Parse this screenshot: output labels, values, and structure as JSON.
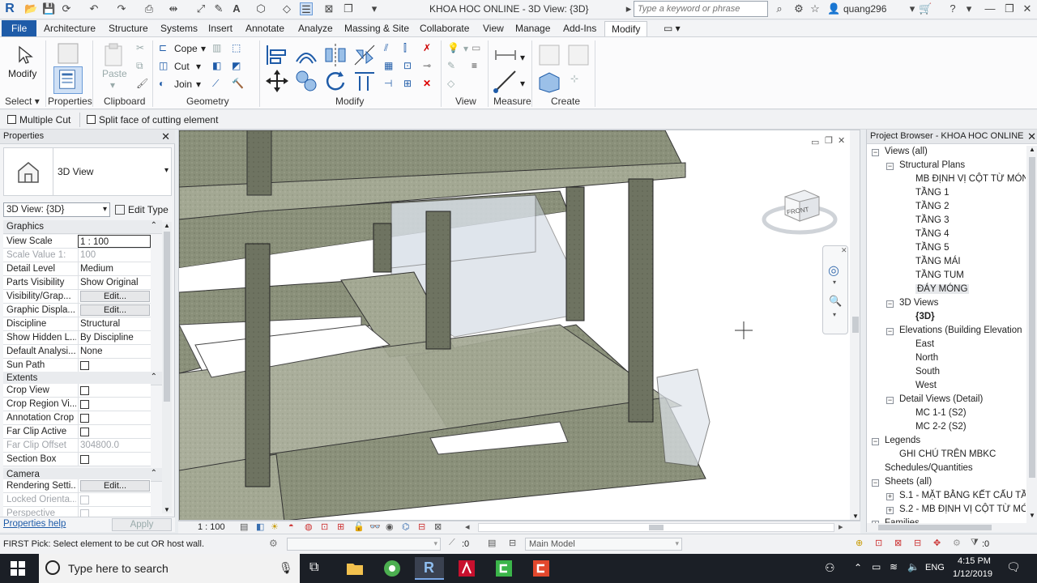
{
  "app": {
    "title": "KHOA HOC ONLINE - 3D View: {3D}",
    "search_placeholder": "Type a keyword or phrase",
    "user": "quang296"
  },
  "ribbon_tabs": [
    "File",
    "Architecture",
    "Structure",
    "Systems",
    "Insert",
    "Annotate",
    "Analyze",
    "Massing & Site",
    "Collaborate",
    "View",
    "Manage",
    "Add-Ins",
    "Modify"
  ],
  "ribbon": {
    "modify_label": "Modify",
    "properties_label": "Properties",
    "paste_label": "Paste",
    "cope_label": "Cope",
    "cut_label": "Cut",
    "join_label": "Join",
    "panels": {
      "select": "Select",
      "properties": "Properties",
      "clipboard": "Clipboard",
      "geometry": "Geometry",
      "modify": "Modify",
      "view": "View",
      "measure": "Measure",
      "create": "Create"
    }
  },
  "options": {
    "multiple_cut": "Multiple Cut",
    "split_face": "Split face of cutting element"
  },
  "properties": {
    "title": "Properties",
    "type_name": "3D View",
    "instance_selector": "3D View: {3D}",
    "edit_type": "Edit Type",
    "sections": {
      "graphics": "Graphics",
      "extents": "Extents",
      "camera": "Camera"
    },
    "graphics_rows": [
      {
        "key": "View Scale",
        "value": "1 : 100"
      },
      {
        "key": "Scale Value    1:",
        "value": "100"
      },
      {
        "key": "Detail Level",
        "value": "Medium"
      },
      {
        "key": "Parts Visibility",
        "value": "Show Original"
      },
      {
        "key": "Visibility/Grap...",
        "value": "Edit..."
      },
      {
        "key": "Graphic Displa...",
        "value": "Edit..."
      },
      {
        "key": "Discipline",
        "value": "Structural"
      },
      {
        "key": "Show Hidden L...",
        "value": "By Discipline"
      },
      {
        "key": "Default Analysi...",
        "value": "None"
      },
      {
        "key": "Sun Path",
        "value": ""
      }
    ],
    "extents_rows": [
      {
        "key": "Crop View",
        "value": ""
      },
      {
        "key": "Crop Region Vi...",
        "value": ""
      },
      {
        "key": "Annotation Crop",
        "value": ""
      },
      {
        "key": "Far Clip Active",
        "value": ""
      },
      {
        "key": "Far Clip Offset",
        "value": "304800.0"
      },
      {
        "key": "Section Box",
        "value": ""
      }
    ],
    "camera_rows": [
      {
        "key": "Rendering Setti...",
        "value": "Edit..."
      },
      {
        "key": "Locked Orienta...",
        "value": ""
      },
      {
        "key": "Perspective",
        "value": ""
      }
    ],
    "help_link": "Properties help",
    "apply": "Apply"
  },
  "view": {
    "scale": "1 : 100",
    "viewcube_face": "FRONT"
  },
  "browser": {
    "title": "Project Browser - KHOA HOC ONLINE",
    "items": [
      {
        "label": "Views (all)",
        "level": 0,
        "toggle": "−"
      },
      {
        "label": "Structural Plans",
        "level": 1,
        "toggle": "−"
      },
      {
        "label": "MB ĐỊNH VỊ CỘT TỪ MÓNG",
        "level": 2
      },
      {
        "label": "TẦNG 1",
        "level": 2
      },
      {
        "label": "TẦNG 2",
        "level": 2
      },
      {
        "label": "TẦNG 3",
        "level": 2
      },
      {
        "label": "TẦNG 4",
        "level": 2
      },
      {
        "label": "TẦNG 5",
        "level": 2
      },
      {
        "label": "TẦNG MÁI",
        "level": 2
      },
      {
        "label": "TẦNG TUM",
        "level": 2
      },
      {
        "label": "ĐÁY MÓNG",
        "level": 2
      },
      {
        "label": "3D Views",
        "level": 1,
        "toggle": "−"
      },
      {
        "label": "{3D}",
        "level": 2
      },
      {
        "label": "Elevations (Building Elevation",
        "level": 1,
        "toggle": "−"
      },
      {
        "label": "East",
        "level": 2
      },
      {
        "label": "North",
        "level": 2
      },
      {
        "label": "South",
        "level": 2
      },
      {
        "label": "West",
        "level": 2
      },
      {
        "label": "Detail Views (Detail)",
        "level": 1,
        "toggle": "−"
      },
      {
        "label": "MC 1-1 (S2)",
        "level": 2
      },
      {
        "label": "MC 2-2 (S2)",
        "level": 2
      },
      {
        "label": "Legends",
        "level": 0,
        "toggle": "−"
      },
      {
        "label": "GHI CHÚ TRÊN MBKC",
        "level": 1
      },
      {
        "label": "Schedules/Quantities",
        "level": 0
      },
      {
        "label": "Sheets (all)",
        "level": 0,
        "toggle": "−"
      },
      {
        "label": "S.1 - MẶT BẰNG KẾT CẤU TẦN",
        "level": 1,
        "toggle": "+"
      },
      {
        "label": "S.2 - MB ĐỊNH VỊ CỘT TỪ MÓN",
        "level": 1,
        "toggle": "+"
      },
      {
        "label": "Families",
        "level": 0,
        "toggle": "+"
      }
    ]
  },
  "status": {
    "message": "FIRST Pick: Select element to be cut OR host wall.",
    "selection_count": ":0",
    "model": "Main Model",
    "filter_count": ":0"
  },
  "taskbar": {
    "search_placeholder": "Type here to search",
    "time": "4:15 PM",
    "date": "1/12/2019",
    "lang": "ENG"
  }
}
